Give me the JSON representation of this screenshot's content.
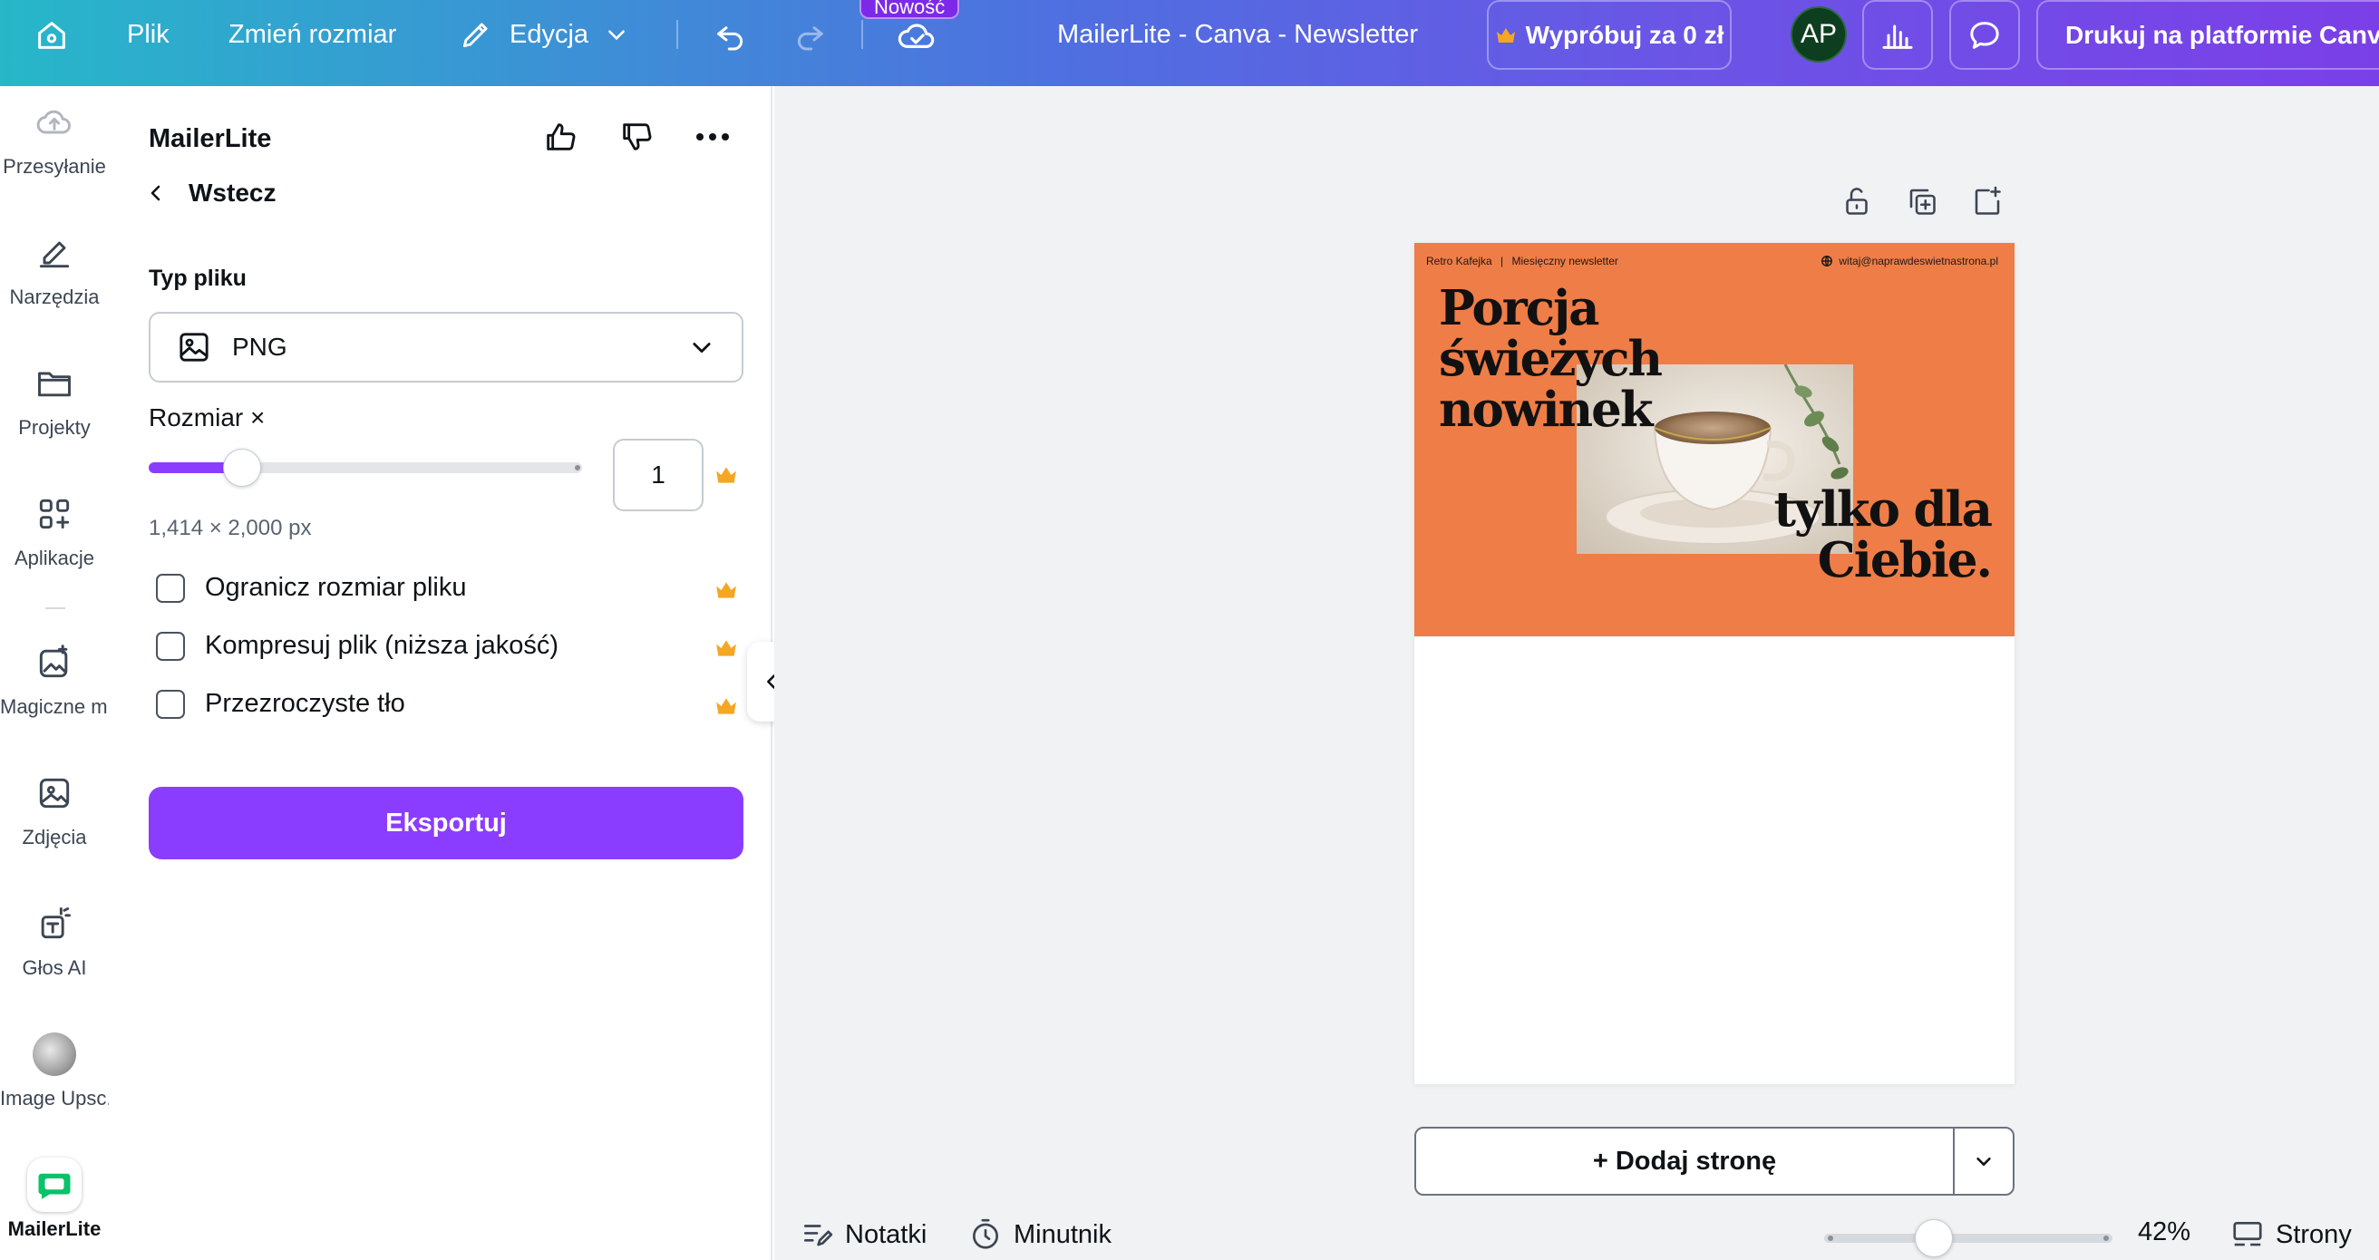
{
  "topbar": {
    "file": "Plik",
    "resize": "Zmień rozmiar",
    "edit": "Edycja",
    "new_badge": "Nowość",
    "doc_title": "MailerLite - Canva - Newsletter",
    "try_free": "Wypróbuj za 0 zł",
    "avatar_initials": "AP",
    "print": "Drukuj na platformie Canva"
  },
  "rail": {
    "items": [
      {
        "label": "Przesyłanie",
        "icon": "cloud-upload-icon"
      },
      {
        "label": "Narzędzia",
        "icon": "pen-tool-icon"
      },
      {
        "label": "Projekty",
        "icon": "folder-icon"
      },
      {
        "label": "Aplikacje",
        "icon": "apps-grid-icon"
      },
      {
        "label": "Magiczne m...",
        "icon": "magic-media-icon"
      },
      {
        "label": "Zdjęcia",
        "icon": "photo-icon"
      },
      {
        "label": "Głos AI",
        "icon": "ai-voice-icon"
      },
      {
        "label": "Image Upsc...",
        "icon": "image-upscaler-icon"
      },
      {
        "label": "MailerLite",
        "icon": "mailerlite-icon"
      }
    ]
  },
  "panel": {
    "title": "MailerLite",
    "back": "Wstecz",
    "file_type_label": "Typ pliku",
    "file_type_value": "PNG",
    "size_label": "Rozmiar ×",
    "size_value": "1",
    "dimensions": "1,414 × 2,000 px",
    "options": [
      {
        "label": "Ogranicz rozmiar pliku",
        "checked": false
      },
      {
        "label": "Kompresuj plik (niższa jakość)",
        "checked": false
      },
      {
        "label": "Przezroczyste tło",
        "checked": false
      }
    ],
    "export": "Eksportuj",
    "premium_color": "#f5a623",
    "accent_color": "#8b3dff"
  },
  "design": {
    "brand": "Retro Kafejka",
    "issue": "Miesięczny newsletter",
    "email": "witaj@naprawdeswietnastrona.pl",
    "headline_1": "Porcja",
    "headline_2": "świeżych",
    "headline_3": "nowinek",
    "headline_4": "tylko dla",
    "headline_5": "Ciebie.",
    "hero_color": "#ef7d47"
  },
  "canvas": {
    "add_page": "+ Dodaj stronę"
  },
  "bottombar": {
    "notes": "Notatki",
    "timer": "Minutnik",
    "zoom": "42%",
    "pages": "Strony"
  }
}
